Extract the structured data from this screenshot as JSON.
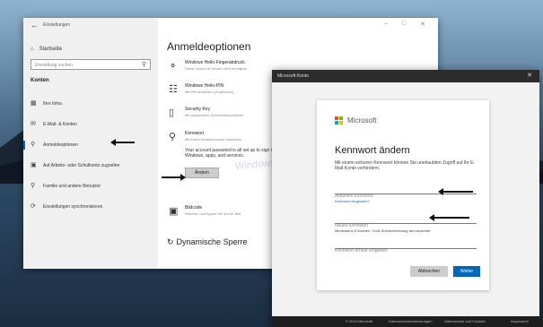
{
  "settings": {
    "title": "Einstellungen",
    "home": "Startseite",
    "search_placeholder": "Einstellung suchen",
    "section": "Konten",
    "nav": [
      {
        "label": "Ihre Infos",
        "icon": "person-card-icon"
      },
      {
        "label": "E-Mail- & Konten",
        "icon": "mail-icon"
      },
      {
        "label": "Anmeldeoptionen",
        "icon": "key-icon"
      },
      {
        "label": "Auf Arbeits- oder Schulkonto zugreifen",
        "icon": "briefcase-icon"
      },
      {
        "label": "Familie und andere Benutzer",
        "icon": "person-add-icon"
      },
      {
        "label": "Einstellungen synchronisieren",
        "icon": "sync-icon"
      }
    ],
    "page_title": "Anmeldeoptionen",
    "options": [
      {
        "title": "Windows Hello-Fingerabdruck",
        "subtitle": "Diese Option ist derzeit nicht verfügbar",
        "icon": "fingerprint-icon"
      },
      {
        "title": "Windows Hello-PIN",
        "subtitle": "Mit PIN anmelden (empfohlen)",
        "icon": "keypad-icon"
      },
      {
        "title": "Security Key",
        "subtitle": "Mit physischem Sicherheitsschlüssel",
        "icon": "usb-key-icon"
      },
      {
        "title": "Kennwort",
        "subtitle": "Mit Ihrem Kontokennwort anmelden",
        "icon": "key-icon"
      }
    ],
    "password_desc": "Your account password is all set up to sign in to Windows, apps, and services.",
    "change_button": "Ändern",
    "picture_title": "Bildcode",
    "picture_subtitle": "Wischen und tippen Sie auf Ihr Bild",
    "dynamic_lock": "Dynamische Sperre",
    "watermark": "Windows-Faq.de"
  },
  "dialog": {
    "title": "Microsoft-Konto",
    "brand": "Microsoft",
    "heading": "Kennwort ändern",
    "description": "Mit einem sicheren Kennwort können Sie unerlaubten Zugriff auf Ihr E-Mail-Konto verhindern.",
    "current_placeholder": "Aktuelles Kennwort",
    "forgot_link": "Kennwort vergessen?",
    "new_placeholder": "Neues Kennwort",
    "hint": "Mindestens 8 Zeichen; Groß-/Kleinschreibung wird beachtet",
    "confirm_placeholder": "Kennwort erneut eingeben",
    "cancel": "Abbrechen",
    "next": "Weiter"
  },
  "footer": {
    "copyright": "© 2019 Microsoft",
    "privacy": "Datenschutzbestimmungen",
    "terms": "Datenschutz und Cookies",
    "imprint": "Impressum"
  }
}
